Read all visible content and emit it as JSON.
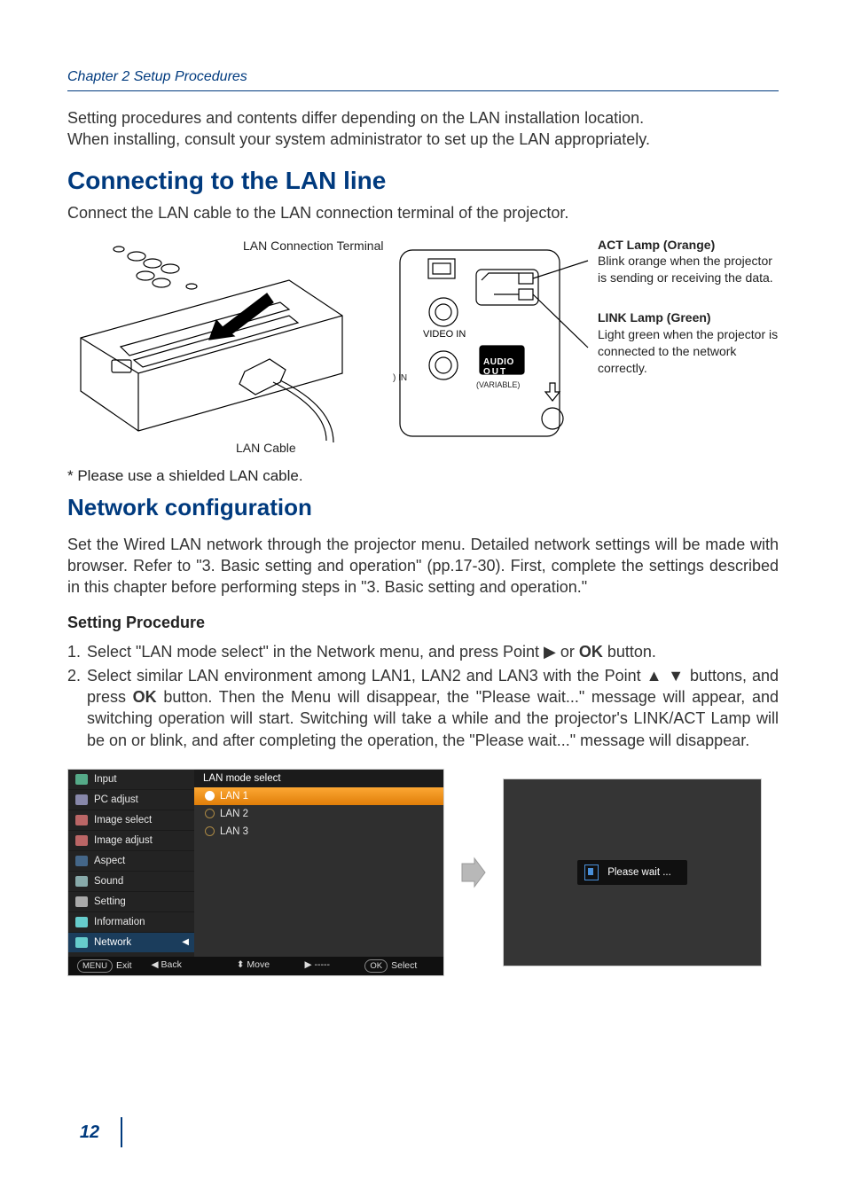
{
  "chapter_heading": "Chapter 2 Setup Procedures",
  "intro_p1": "Setting procedures and contents differ depending on the LAN installation location.",
  "intro_p2": "When installing, consult your system administrator to set up the LAN appropriately.",
  "section1_title": "Connecting to the LAN line",
  "section1_lead": "Connect the LAN cable to the LAN connection terminal of the projector.",
  "diagram": {
    "lan_connection_terminal_label": "LAN Connection Terminal",
    "lan_cable_label": "LAN Cable",
    "port_panel": {
      "video_in": "VIDEO IN",
      "audio_out_top": "AUDIO",
      "audio_out_bottom": "OUT",
      "variable": "(VARIABLE)",
      "in_suffix": ") IN"
    },
    "act_lamp": {
      "title": "ACT Lamp (Orange)",
      "desc": "Blink orange when the projector is sending or receiving the data."
    },
    "link_lamp": {
      "title": "LINK Lamp (Green)",
      "desc": "Light green when the projector is connected to the network correctly."
    }
  },
  "footnote": "* Please use a shielded LAN cable.",
  "section2_title": "Network configuration",
  "section2_para": "Set the Wired LAN network through the projector menu. Detailed network settings will be made with browser. Refer to \"3. Basic setting and operation\" (pp.17-30). First, complete the settings described in this chapter before performing steps in \"3. Basic setting and operation.\"",
  "setting_procedure_title": "Setting Procedure",
  "steps": {
    "s1_pre": "Select \"LAN mode select\" in the Network menu, and press Point ",
    "s1_mid": " or ",
    "s1_ok": "OK",
    "s1_post": " button.",
    "s2_pre": "Select similar LAN environment among LAN1, LAN2 and LAN3 with the Point ",
    "s2_mid1": " buttons, and press ",
    "s2_ok": "OK",
    "s2_post": " button. Then the Menu will disappear, the \"Please wait...\" message will appear, and switching operation will start. Switching will take a while and the projector's LINK/ACT Lamp will be on or blink, and after completing the operation, the \"Please wait...\" message will disappear."
  },
  "menu": {
    "sidebar": [
      "Input",
      "PC adjust",
      "Image select",
      "Image adjust",
      "Aspect",
      "Sound",
      "Setting",
      "Information",
      "Network"
    ],
    "main_title": "LAN mode select",
    "lan_options": [
      "LAN 1",
      "LAN 2",
      "LAN 3"
    ],
    "footer": {
      "exit_icon": "MENU",
      "exit": "Exit",
      "back_icon": "◀",
      "back": "Back",
      "move_icon": "⯁",
      "move": "Move",
      "next_icon": "▶",
      "next": "-----",
      "select_icon": "OK",
      "select": "Select"
    }
  },
  "please_wait": "Please wait ...",
  "page_number": "12"
}
